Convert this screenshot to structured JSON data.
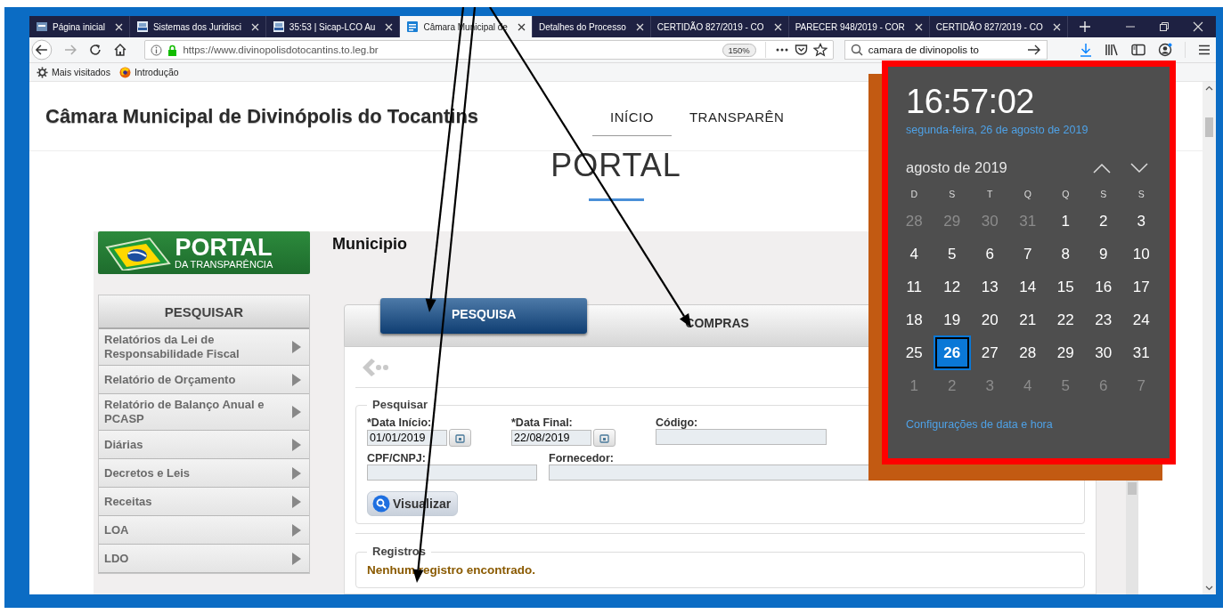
{
  "browser": {
    "tabs": [
      {
        "label": "Página inicial",
        "selected": false
      },
      {
        "label": "Sistemas dos Juridisci",
        "selected": false
      },
      {
        "label": "35:53 | Sicap-LCO Au",
        "selected": false
      },
      {
        "label": "Câmara Municipal de",
        "selected": true
      },
      {
        "label": "Detalhes do Processo",
        "selected": false
      },
      {
        "label": "CERTIDÃO 827/2019 - CO",
        "selected": false
      },
      {
        "label": "PARECER 948/2019 - COR",
        "selected": false
      },
      {
        "label": "CERTIDÃO 827/2019 - CO",
        "selected": false
      }
    ],
    "url": "https://www.divinopolisdotocantins.to.leg.br",
    "zoom": "150%",
    "search": {
      "value": "camara de divinopolis to"
    },
    "bookmarks": [
      {
        "label": "Mais visitados"
      },
      {
        "label": "Introdução"
      }
    ]
  },
  "site": {
    "title": "Câmara Municipal de Divinópolis do Tocantins",
    "nav": [
      {
        "label": "INÍCIO",
        "selected": true
      },
      {
        "label": "TRANSPARÊN",
        "selected": false
      }
    ],
    "heading": "PORTAL"
  },
  "portal": {
    "logo": {
      "title": "PORTAL",
      "subtitle": "DA TRANSPARÊNCIA"
    },
    "menu": {
      "title": "PESQUISAR",
      "items": [
        "Relatórios da Lei de Responsabilidade Fiscal",
        "Relatório de Orçamento",
        "Relatório de Balanço Anual e PCASP",
        "Diárias",
        "Decretos e Leis",
        "Receitas",
        "LOA",
        "LDO"
      ]
    },
    "section_title": "Municipio",
    "tabs": [
      {
        "label": "PESQUISA",
        "selected": true
      },
      {
        "label": "COMPRAS",
        "selected": false
      }
    ],
    "search_form": {
      "legend": "Pesquisar",
      "rows": [
        [
          {
            "label": "*Data Início:",
            "value": "01/01/2019",
            "kind": "date"
          },
          {
            "label": "*Data Final:",
            "value": "22/08/2019",
            "kind": "date"
          },
          {
            "label": "Código:",
            "kind": "text"
          }
        ],
        [
          {
            "label": "CPF/CNPJ:",
            "kind": "text"
          },
          {
            "label": "Fornecedor:",
            "kind": "text"
          }
        ]
      ],
      "button": "Visualizar"
    },
    "records": {
      "legend": "Registros",
      "message": "Nenhum registro encontrado."
    }
  },
  "calendar": {
    "time": "16:57:02",
    "date": "segunda-feira, 26 de agosto de 2019",
    "month": "agosto de 2019",
    "weekdays": [
      "D",
      "S",
      "T",
      "Q",
      "Q",
      "S",
      "S"
    ],
    "days": [
      {
        "label": "28",
        "muted": true,
        "selected": false
      },
      {
        "label": "29",
        "muted": true,
        "selected": false
      },
      {
        "label": "30",
        "muted": true,
        "selected": false
      },
      {
        "label": "31",
        "muted": true,
        "selected": false
      },
      {
        "label": "1",
        "muted": false,
        "selected": false
      },
      {
        "label": "2",
        "muted": false,
        "selected": false
      },
      {
        "label": "3",
        "muted": false,
        "selected": false
      },
      {
        "label": "4",
        "muted": false,
        "selected": false
      },
      {
        "label": "5",
        "muted": false,
        "selected": false
      },
      {
        "label": "6",
        "muted": false,
        "selected": false
      },
      {
        "label": "7",
        "muted": false,
        "selected": false
      },
      {
        "label": "8",
        "muted": false,
        "selected": false
      },
      {
        "label": "9",
        "muted": false,
        "selected": false
      },
      {
        "label": "10",
        "muted": false,
        "selected": false
      },
      {
        "label": "11",
        "muted": false,
        "selected": false
      },
      {
        "label": "12",
        "muted": false,
        "selected": false
      },
      {
        "label": "13",
        "muted": false,
        "selected": false
      },
      {
        "label": "14",
        "muted": false,
        "selected": false
      },
      {
        "label": "15",
        "muted": false,
        "selected": false
      },
      {
        "label": "16",
        "muted": false,
        "selected": false
      },
      {
        "label": "17",
        "muted": false,
        "selected": false
      },
      {
        "label": "18",
        "muted": false,
        "selected": false
      },
      {
        "label": "19",
        "muted": false,
        "selected": false
      },
      {
        "label": "20",
        "muted": false,
        "selected": false
      },
      {
        "label": "21",
        "muted": false,
        "selected": false
      },
      {
        "label": "22",
        "muted": false,
        "selected": false
      },
      {
        "label": "23",
        "muted": false,
        "selected": false
      },
      {
        "label": "24",
        "muted": false,
        "selected": false
      },
      {
        "label": "25",
        "muted": false,
        "selected": false
      },
      {
        "label": "26",
        "muted": false,
        "selected": true
      },
      {
        "label": "27",
        "muted": false,
        "selected": false
      },
      {
        "label": "28",
        "muted": false,
        "selected": false
      },
      {
        "label": "29",
        "muted": false,
        "selected": false
      },
      {
        "label": "30",
        "muted": false,
        "selected": false
      },
      {
        "label": "31",
        "muted": false,
        "selected": false
      },
      {
        "label": "1",
        "muted": true,
        "selected": false
      },
      {
        "label": "2",
        "muted": true,
        "selected": false
      },
      {
        "label": "3",
        "muted": true,
        "selected": false
      },
      {
        "label": "4",
        "muted": true,
        "selected": false
      },
      {
        "label": "5",
        "muted": true,
        "selected": false
      },
      {
        "label": "6",
        "muted": true,
        "selected": false
      },
      {
        "label": "7",
        "muted": true,
        "selected": false
      }
    ],
    "settings_link": "Configurações de data e hora"
  },
  "annotations": [
    {
      "kind": "arrow"
    },
    {
      "kind": "arrow"
    },
    {
      "kind": "arrow"
    }
  ]
}
